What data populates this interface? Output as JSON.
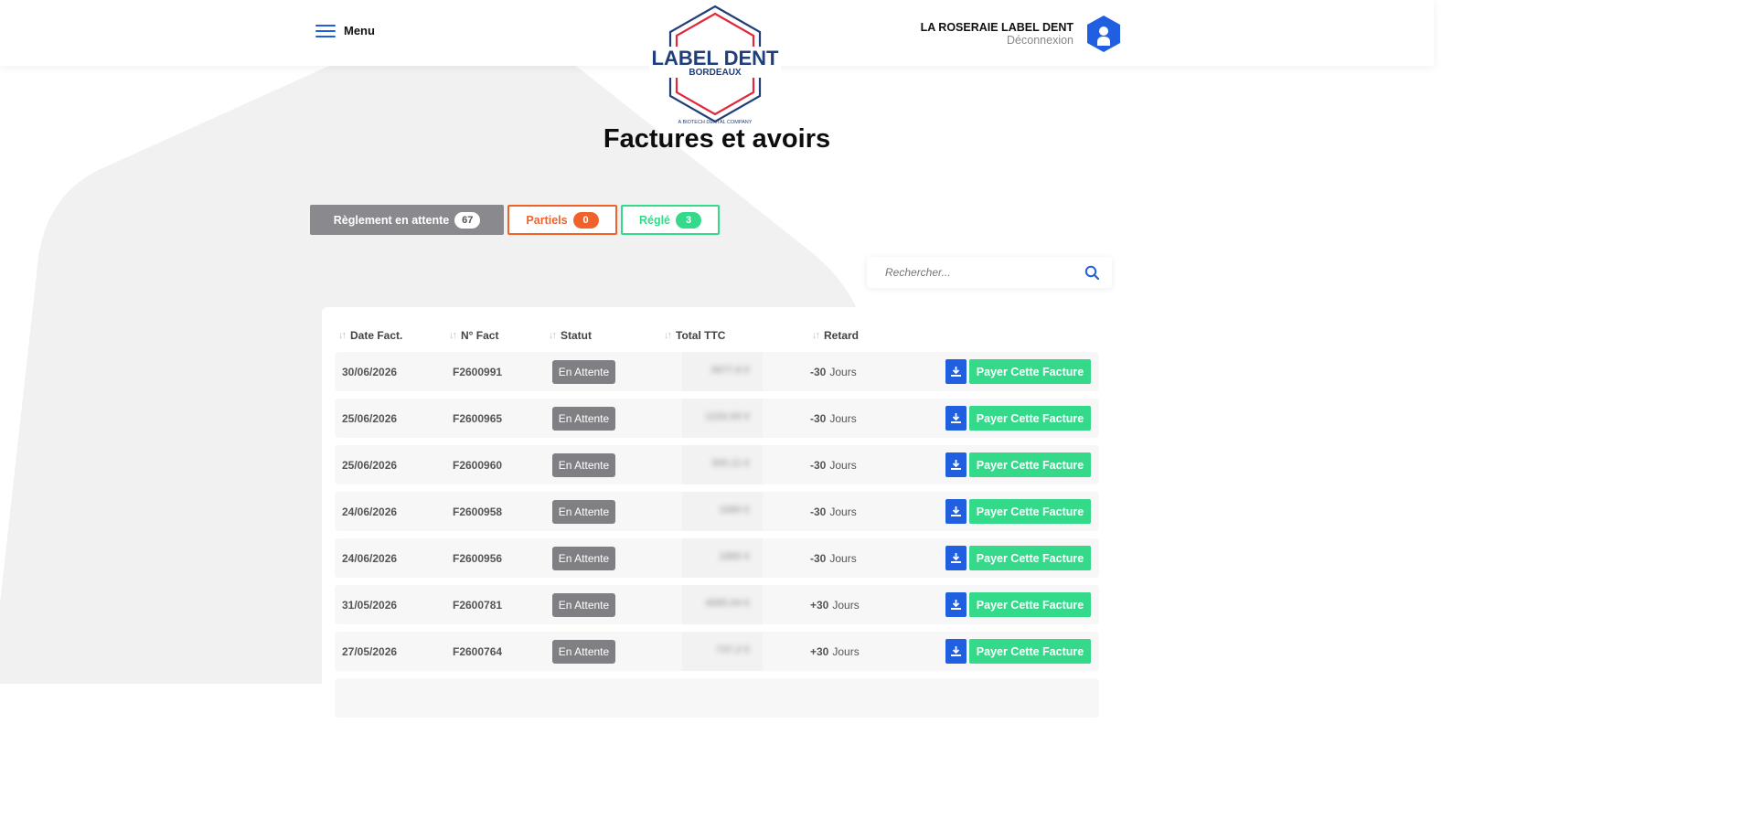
{
  "header": {
    "menu_label": "Menu",
    "logo": {
      "line1": "LABEL DENT",
      "line2": "BORDEAUX",
      "tagline": "A BIOTECH DENTAL COMPANY"
    },
    "user_name": "LA ROSERAIE LABEL DENT",
    "logout_label": "Déconnexion"
  },
  "page_title": "Factures et avoirs",
  "tabs": [
    {
      "label": "Règlement en attente",
      "count": "67"
    },
    {
      "label": "Partiels",
      "count": "0"
    },
    {
      "label": "Réglé",
      "count": "3"
    }
  ],
  "search": {
    "placeholder": "Rechercher..."
  },
  "table": {
    "columns": [
      "Date Fact.",
      "N° Fact",
      "Statut",
      "Total TTC",
      "Retard"
    ],
    "rows": [
      {
        "date": "30/06/2026",
        "number": "F2600991",
        "status": "En Attente",
        "total": "3677.8 €",
        "retard_value": "-30",
        "retard_unit": "Jours"
      },
      {
        "date": "25/06/2026",
        "number": "F2600965",
        "status": "En Attente",
        "total": "1220.00 €",
        "retard_value": "-30",
        "retard_unit": "Jours"
      },
      {
        "date": "25/06/2026",
        "number": "F2600960",
        "status": "En Attente",
        "total": "300.11 €",
        "retard_value": "-30",
        "retard_unit": "Jours"
      },
      {
        "date": "24/06/2026",
        "number": "F2600958",
        "status": "En Attente",
        "total": "1680 €",
        "retard_value": "-30",
        "retard_unit": "Jours"
      },
      {
        "date": "24/06/2026",
        "number": "F2600956",
        "status": "En Attente",
        "total": "1880 €",
        "retard_value": "-30",
        "retard_unit": "Jours"
      },
      {
        "date": "31/05/2026",
        "number": "F2600781",
        "status": "En Attente",
        "total": "4085.04 €",
        "retard_value": "+30",
        "retard_unit": "Jours"
      },
      {
        "date": "27/05/2026",
        "number": "F2600764",
        "status": "En Attente",
        "total": "737.2 €",
        "retard_value": "+30",
        "retard_unit": "Jours"
      }
    ],
    "pay_label": "Payer Cette Facture"
  },
  "colors": {
    "accent_blue": "#1f5fe0",
    "pay_green": "#35d98a",
    "partial_orange": "#f0622a",
    "pending_gray": "#8a8a8e",
    "logo_navy": "#1f3f7a",
    "logo_red": "#e0283c"
  }
}
